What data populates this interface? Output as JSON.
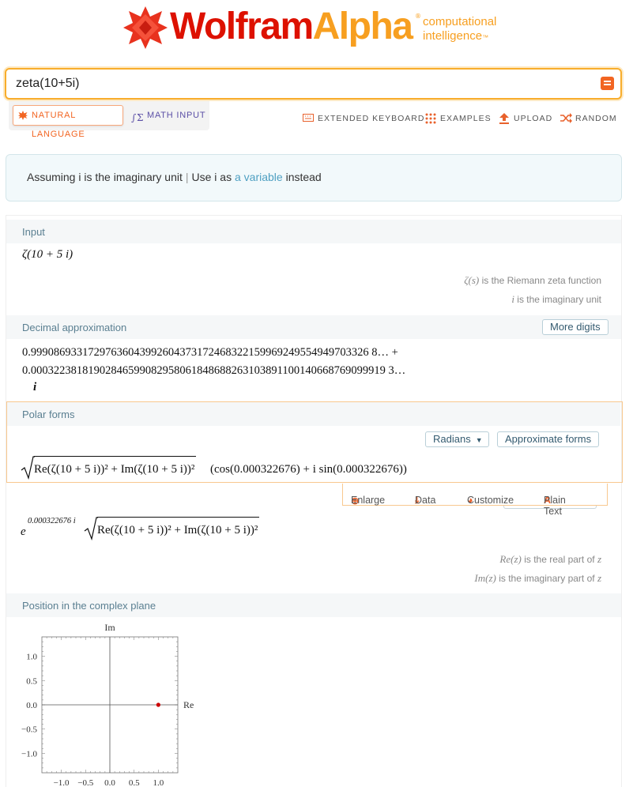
{
  "brand": {
    "name_part1": "Wolfram",
    "name_part2": "Alpha",
    "registered": "®",
    "tagline_line1": "computational",
    "tagline_line2": "intelligence",
    "trademark": "™",
    "red": "#dd1100",
    "orange": "#f79f20"
  },
  "search": {
    "value": "zeta(10+5i)",
    "button_icon": "equals-icon"
  },
  "modes": {
    "natural_language": "NATURAL LANGUAGE",
    "math_input": "MATH INPUT"
  },
  "tools": {
    "extended_keyboard": "EXTENDED KEYBOARD",
    "examples": "EXAMPLES",
    "upload": "UPLOAD",
    "random": "RANDOM"
  },
  "assumption": {
    "text": "Assuming i is the imaginary unit",
    "separator": "|",
    "alt_prefix": "Use i as",
    "alt_link": "a variable",
    "alt_suffix": "instead"
  },
  "pods": {
    "input": {
      "title": "Input",
      "expression": "ζ(10 + 5 i)",
      "note1_sym": "ζ(s)",
      "note1_text": "is the Riemann zeta function",
      "note2_sym": "i",
      "note2_text": "is the imaginary unit"
    },
    "decimal": {
      "title": "Decimal approximation",
      "more_digits": "More digits",
      "line1": "0.99908693317297636043992604373172468322159969249554949703326 8… +",
      "line2": "0.00032238181902846599082958061848688263103891100140668769099919 3…",
      "line3": "i"
    },
    "polar": {
      "title": "Polar forms",
      "radians": "Radians",
      "approximate_forms": "Approximate forms",
      "sqrt_content": "Re(ζ(10 + 5 i))² + Im(ζ(10 + 5 i))²",
      "trig_part": "(cos(0.000322676) + i sin(0.000322676))",
      "exp_base": "e",
      "exp_power": "0.000322676 i",
      "note1_sym": "Re(z)",
      "note1_text": "is the real part of",
      "note1_var": "z",
      "note2_sym": "Im(z)",
      "note2_text": "is the imaginary part of",
      "note2_var": "z",
      "toolbar": {
        "enlarge": "Enlarge",
        "data": "Data",
        "customize": "Customize",
        "plain_text": "Plain Text"
      }
    },
    "complex_plane": {
      "title": "Position in the complex plane"
    }
  },
  "chart_data": {
    "type": "scatter",
    "xlabel": "Re",
    "ylabel": "Im",
    "xlim": [
      -1.4,
      1.4
    ],
    "ylim": [
      -1.4,
      1.4
    ],
    "x_ticks": [
      "−1.0",
      "−0.5",
      "0.0",
      "0.5",
      "1.0"
    ],
    "y_ticks": [
      "1.0",
      "0.5",
      "0.0",
      "−0.5",
      "−1.0"
    ],
    "points": [
      {
        "x": 0.999,
        "y": 0.000322
      }
    ],
    "point_color": "#cc0000",
    "grid": false
  }
}
